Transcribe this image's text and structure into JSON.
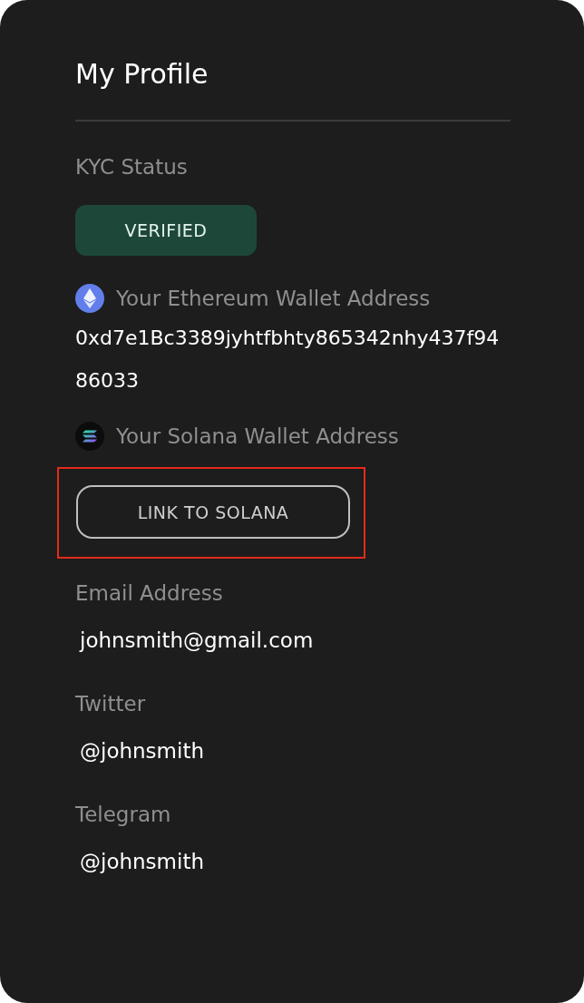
{
  "title": "My Profile",
  "kyc": {
    "label": "KYC Status",
    "status": "VERIFIED",
    "verified": true
  },
  "ethereum": {
    "label": "Your Ethereum Wallet Address",
    "address": "0xd7e1Bc3389jyhtfbhty865342nhy437f9486033"
  },
  "solana": {
    "label": "Your Solana Wallet Address",
    "button": "LINK TO SOLANA",
    "highlighted": true
  },
  "fields": [
    {
      "label": "Email Address",
      "value": "johnsmith@gmail.com"
    },
    {
      "label": "Twitter",
      "value": "@johnsmith"
    },
    {
      "label": "Telegram",
      "value": "@johnsmith"
    }
  ]
}
